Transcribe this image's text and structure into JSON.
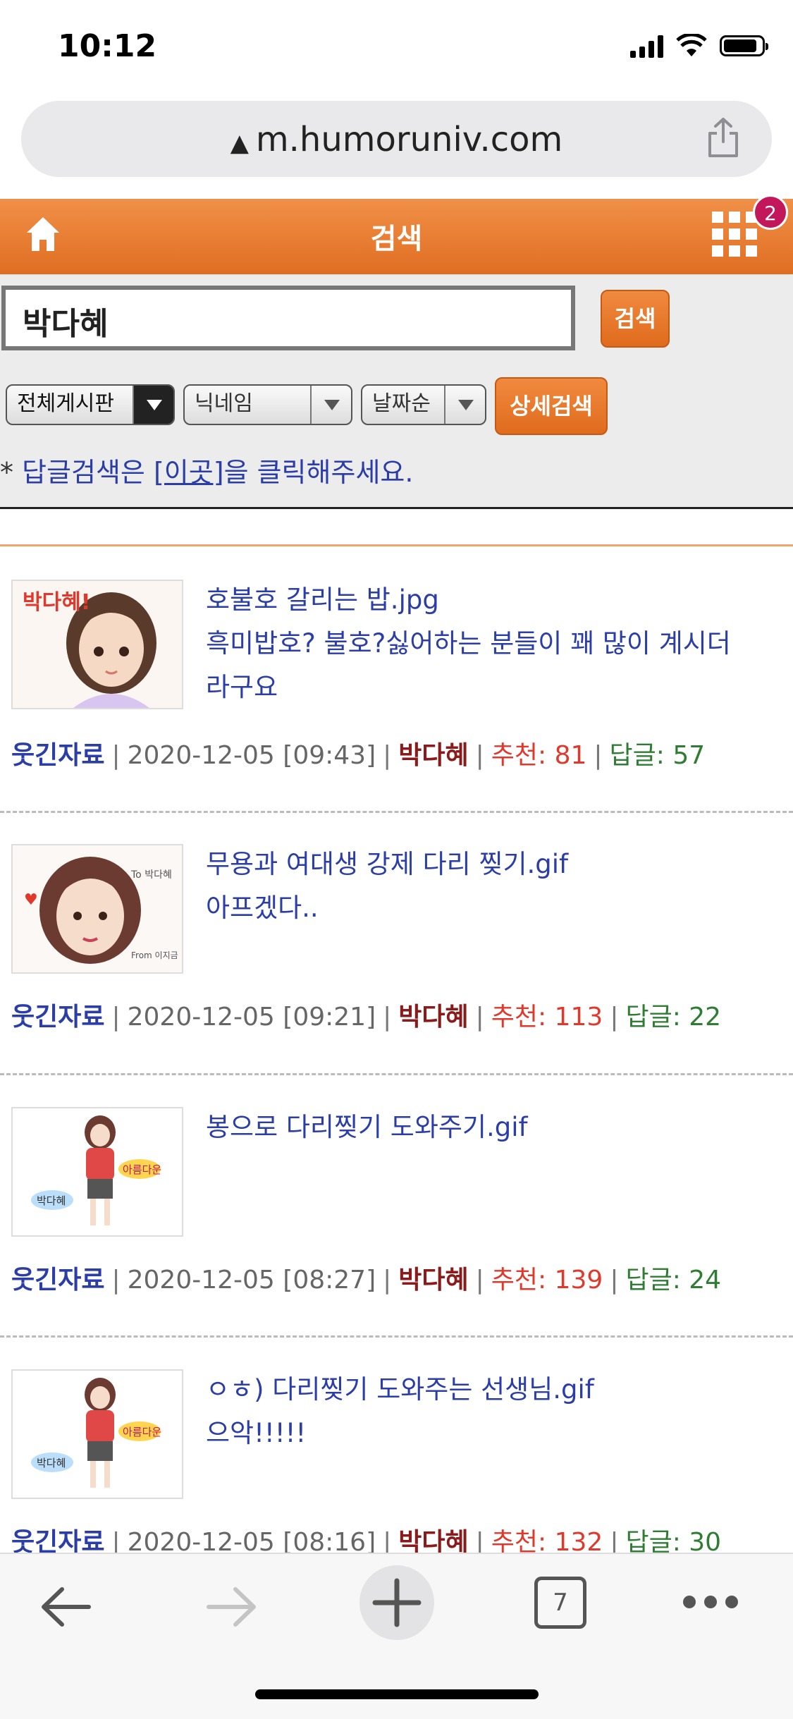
{
  "status_bar": {
    "time": "10:12"
  },
  "browser": {
    "url": "m.humoruniv.com",
    "tab_count": "7"
  },
  "header": {
    "title": "검색",
    "badge": "2"
  },
  "search": {
    "query": "박다혜",
    "search_button": "검색",
    "board_select": "전체게시판",
    "field_select": "닉네임",
    "sort_select": "날짜순",
    "detail_button": "상세검색",
    "notice_prefix": "* ",
    "notice_before": "답글검색은 ",
    "notice_link": "[이곳]",
    "notice_after": "을 클릭해주세요."
  },
  "results": [
    {
      "title_line1": "호불호 갈리는 밥.jpg",
      "title_line2": "흑미밥호? 불호?싫어하는 분들이 꽤 많이 계시더",
      "title_line3": "라구요",
      "category": "웃긴자료",
      "datetime": "2020-12-05 [09:43]",
      "author": "박다혜",
      "recommend": "추천: 81",
      "replies": "답글: 57"
    },
    {
      "title_line1": "무용과 여대생 강제 다리 찢기.gif",
      "title_line2": "아프겠다..",
      "title_line3": "",
      "category": "웃긴자료",
      "datetime": "2020-12-05 [09:21]",
      "author": "박다혜",
      "recommend": "추천: 113",
      "replies": "답글: 22"
    },
    {
      "title_line1": "봉으로 다리찢기 도와주기.gif",
      "title_line2": "",
      "title_line3": "",
      "category": "웃긴자료",
      "datetime": "2020-12-05 [08:27]",
      "author": "박다혜",
      "recommend": "추천: 139",
      "replies": "답글: 24"
    },
    {
      "title_line1": "ㅇㅎ) 다리찢기 도와주는 선생님.gif",
      "title_line2": "으악!!!!!",
      "title_line3": "",
      "category": "웃긴자료",
      "datetime": "2020-12-05 [08:16]",
      "author": "박다혜",
      "recommend": "추천: 132",
      "replies": "답글: 30"
    }
  ],
  "thumb_labels": {
    "t1": "박다혜!",
    "t2_to": "To 박다혜",
    "t2_from": "From 이지금",
    "t3_tag1": "아름다운",
    "t3_tag2": "박다혜",
    "t4_tag1": "아름다운",
    "t4_tag2": "박다혜"
  }
}
